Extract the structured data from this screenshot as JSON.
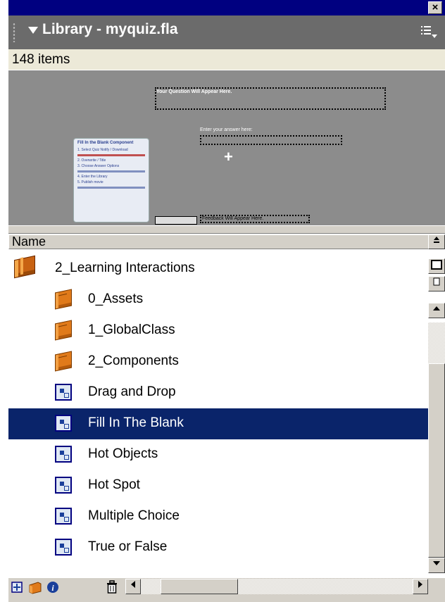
{
  "window": {
    "close_glyph": "×"
  },
  "panel": {
    "title": "Library - myquiz.fla",
    "count": "148 items",
    "options_icon": "panel-options-icon"
  },
  "preview": {
    "question_text": "Your Question Will Appear Here.",
    "answer_prompt": "Enter your answer here:",
    "feedback_text": "Feedback Will Appear Here.",
    "card_title": "Fill In the Blank Component",
    "card_steps": [
      "1. Select Quiz Notify / Download",
      "2. Overwrite / Title",
      "3. Choose Answer Options",
      "4. Enter the Library",
      "5. Publish movie"
    ]
  },
  "columns": {
    "name": "Name"
  },
  "list": {
    "items": [
      {
        "label": "2_Learning Interactions",
        "type": "open-folder",
        "icon": "open-folder-icon",
        "indent": 0,
        "selected": false
      },
      {
        "label": "0_Assets",
        "type": "folder",
        "icon": "folder-icon",
        "indent": 1,
        "selected": false
      },
      {
        "label": "1_GlobalClass",
        "type": "folder",
        "icon": "folder-icon",
        "indent": 1,
        "selected": false
      },
      {
        "label": "2_Components",
        "type": "folder",
        "icon": "folder-icon",
        "indent": 1,
        "selected": false
      },
      {
        "label": "Drag and Drop",
        "type": "movieclip",
        "icon": "movie-clip-icon",
        "indent": 1,
        "selected": false
      },
      {
        "label": "Fill In The Blank",
        "type": "movieclip",
        "icon": "movie-clip-icon",
        "indent": 1,
        "selected": true
      },
      {
        "label": "Hot Objects",
        "type": "movieclip",
        "icon": "movie-clip-icon",
        "indent": 1,
        "selected": false
      },
      {
        "label": "Hot Spot",
        "type": "movieclip",
        "icon": "movie-clip-icon",
        "indent": 1,
        "selected": false
      },
      {
        "label": "Multiple Choice",
        "type": "movieclip",
        "icon": "movie-clip-icon",
        "indent": 1,
        "selected": false
      },
      {
        "label": "True or False",
        "type": "movieclip",
        "icon": "movie-clip-icon",
        "indent": 1,
        "selected": false
      }
    ]
  },
  "toolbar": {
    "new_symbol_icon": "new-symbol-icon",
    "new_folder_icon": "new-folder-icon",
    "properties_icon": "properties-icon",
    "delete_icon": "trash-icon"
  },
  "colors": {
    "title_bar": "#000080",
    "panel_header": "#6b6b6b",
    "selection": "#0a246a",
    "chrome": "#d4d0c8"
  }
}
